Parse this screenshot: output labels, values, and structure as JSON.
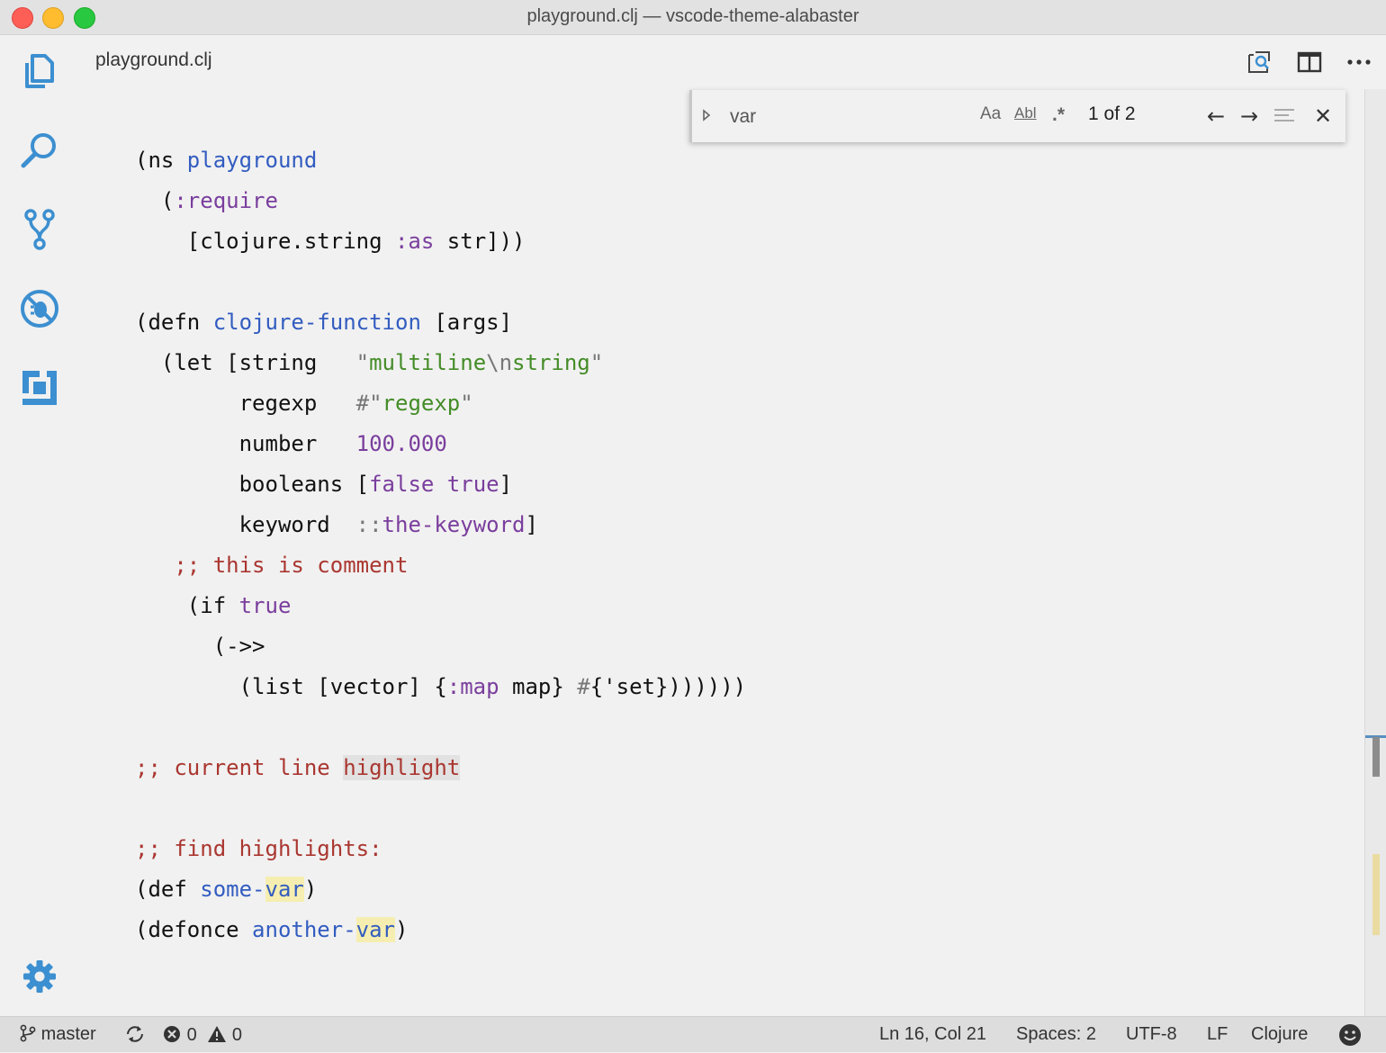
{
  "window": {
    "title": "playground.clj — vscode-theme-alabaster"
  },
  "activity_bar": {
    "items": [
      {
        "icon": "files-icon"
      },
      {
        "icon": "search-icon"
      },
      {
        "icon": "source-control-icon"
      },
      {
        "icon": "debug-icon"
      },
      {
        "icon": "extensions-icon"
      }
    ],
    "settings_icon": "gear-icon"
  },
  "tab": {
    "label": "playground.clj"
  },
  "toolbar": {
    "icons": [
      "open-preview-icon",
      "split-editor-icon",
      "more-actions-icon"
    ]
  },
  "find_widget": {
    "value": "var",
    "match_case": "Aa",
    "whole_word": "Abl",
    "regex": ".*",
    "count": "1 of 2",
    "prev": "←",
    "next": "→",
    "close": "✕"
  },
  "code": {
    "l1": {
      "a": "(ns ",
      "b": "playground"
    },
    "l2": {
      "a": "  (",
      "b": ":require"
    },
    "l3": {
      "a": "    [clojure.string ",
      "b": ":as",
      "c": " str]))"
    },
    "l5": {
      "a": "(defn ",
      "b": "clojure-function",
      "c": " [args]"
    },
    "l6": {
      "a": "  (let [string   ",
      "q1": "\"",
      "b": "multiline",
      "esc": "\\n",
      "c": "string",
      "q2": "\""
    },
    "l7": {
      "a": "        regexp   ",
      "h": "#\"",
      "b": "regexp",
      "q": "\""
    },
    "l8": {
      "a": "        number   ",
      "b": "100.000"
    },
    "l9": {
      "a": "        booleans [",
      "b": "false",
      "sp": " ",
      "c": "true",
      "d": "]"
    },
    "l10": {
      "a": "        keyword  ",
      "p": "::",
      "b": "the-keyword",
      "c": "]"
    },
    "l11": {
      "p": "   ;;",
      "b": " this is comment"
    },
    "l12": {
      "a": "    (if ",
      "b": "true"
    },
    "l13": {
      "a": "      (->>"
    },
    "l14": {
      "a": "        (list [vector] {",
      "b": ":map",
      "c": " map} ",
      "h": "#",
      "d": "{'set}))))))"
    },
    "l16": {
      "p": ";;",
      "b": " current line ",
      "c": "highlight"
    },
    "l18": {
      "p": ";;",
      "b": " find highlights:"
    },
    "l19": {
      "a": "(def ",
      "b": "some-",
      "c": "var",
      "d": ")"
    },
    "l20": {
      "a": "(defonce ",
      "b": "another-",
      "c": "var",
      "d": ")"
    }
  },
  "status": {
    "branch": "master",
    "errors": "0",
    "warnings": "0",
    "position": "Ln 16, Col 21",
    "spaces": "Spaces: 2",
    "encoding": "UTF-8",
    "eol": "LF",
    "language": "Clojure",
    "feedback_icon": "smiley-icon"
  },
  "colors": {
    "accent": "#3c8fd0",
    "definition": "#325cc0",
    "constant": "#7a3e9d",
    "string": "#448c27",
    "comment": "#aa3731",
    "find_highlight": "#f6eeb0"
  }
}
